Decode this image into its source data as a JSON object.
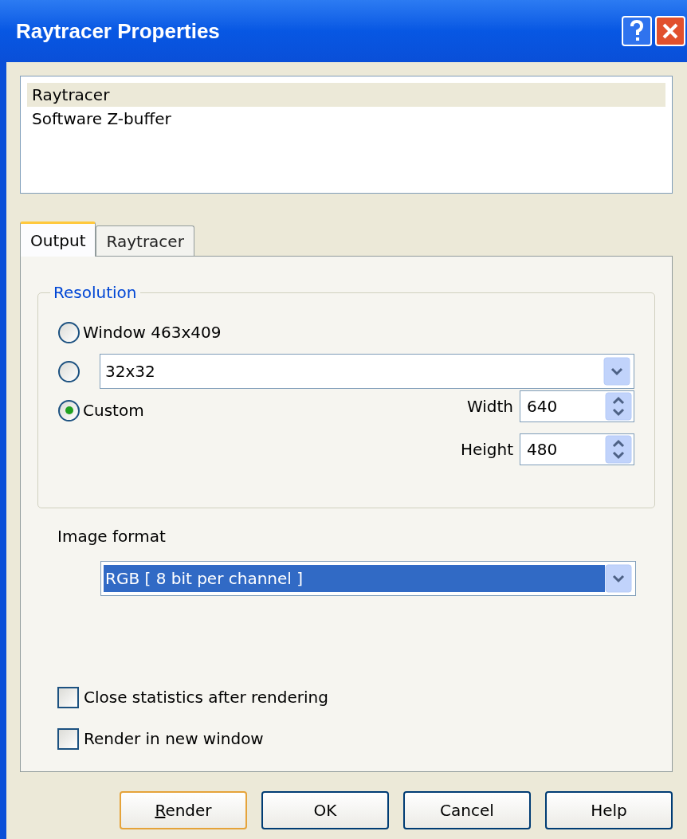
{
  "window": {
    "title": "Raytracer Properties"
  },
  "renderers": [
    {
      "label": "Raytracer",
      "selected": true
    },
    {
      "label": "Software Z-buffer",
      "selected": false
    }
  ],
  "tabs": [
    {
      "label": "Output",
      "selected": true
    },
    {
      "label": "Raytracer",
      "selected": false
    }
  ],
  "resolution": {
    "title": "Resolution",
    "options": [
      {
        "kind": "label",
        "label": "Window 463x409",
        "selected": false
      },
      {
        "kind": "combo",
        "value": "32x32",
        "selected": false
      },
      {
        "kind": "custom",
        "label": "Custom",
        "selected": true,
        "fields": [
          {
            "label": "Width",
            "value": "640"
          },
          {
            "label": "Height",
            "value": "480"
          }
        ]
      }
    ]
  },
  "image_format": {
    "label": "Image format",
    "value": "RGB  [ 8 bit per channel ]",
    "focused": true
  },
  "checkboxes": [
    {
      "label": "Close statistics after rendering",
      "checked": false
    },
    {
      "label": "Render in new window",
      "checked": false
    }
  ],
  "buttons": [
    {
      "label": "Render",
      "default": true,
      "mnemonic": true
    },
    {
      "label": "OK",
      "default": false,
      "mnemonic": false
    },
    {
      "label": "Cancel",
      "default": false,
      "mnemonic": false
    },
    {
      "label": "Help",
      "default": false,
      "mnemonic": false
    }
  ]
}
